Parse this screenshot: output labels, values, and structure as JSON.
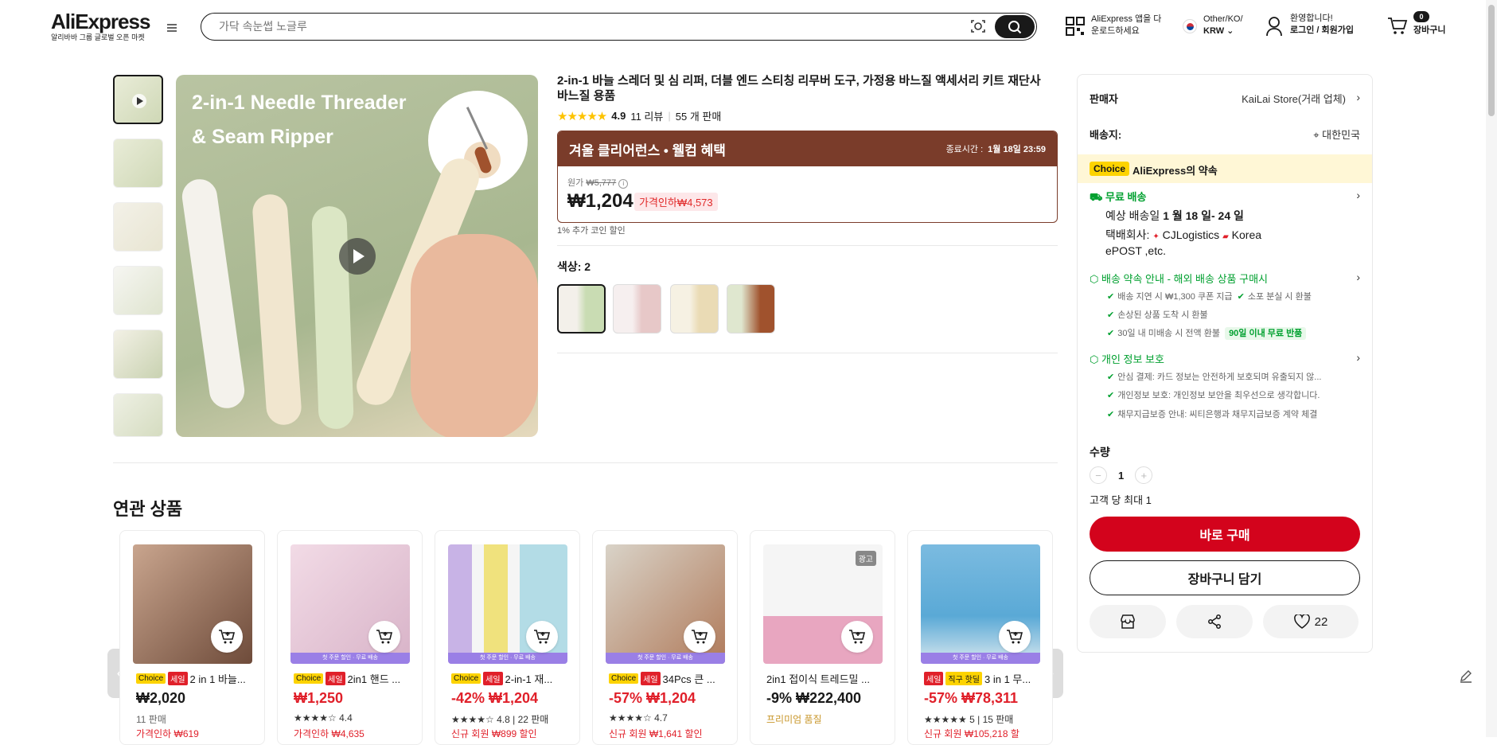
{
  "header": {
    "logo": "AliExpress",
    "logo_sub": "알리바바 그룹 글로벌 오픈 마켓",
    "search_placeholder": "가닥 속눈썹 노글루",
    "app_line1": "AliExpress 앱을 다",
    "app_line2": "운로드하세요",
    "region_line1": "Other/KO/",
    "region_line2": "KRW",
    "account_line1": "환영합니다!",
    "account_line2": "로그인 / 회원가입",
    "cart_count": "0",
    "cart_label": "장바구니"
  },
  "product": {
    "title": "2-in-1 바늘 스레더 및 심 리퍼, 더블 엔드 스티칭 리무버 도구, 가정용 바느질 액세서리 키트 재단사 바느질 용품",
    "rating": "4.9",
    "reviews": "11 리뷰",
    "sold": "55 개 판매",
    "image_text_line1": "2-in-1 Needle Threader",
    "image_text_line2": "& Seam Ripper",
    "promo_title": "겨울 클리어런스 • 웰컴 혜택",
    "promo_end_label": "종료시간 :",
    "promo_end_value": "1월 18일 23:59",
    "orig_label": "원가",
    "orig_price": "₩5,777",
    "price": "₩1,204",
    "discount_tag": "가격인하₩4,573",
    "coin_note": "1% 추가 코인 할인",
    "color_label": "색상: 2",
    "swatch_labels": [
      "Green",
      "Pink",
      "Yellow",
      "Set"
    ]
  },
  "panel": {
    "seller_label": "판매자",
    "seller_value": "KaiLai Store(거래 업체)",
    "ship_to_label": "배송지:",
    "ship_to_value": "대한민국",
    "choice_badge": "Choice",
    "promise": "AliExpress의 약속",
    "free_ship": "무료 배송",
    "eta_prefix": "예상 배송일",
    "eta_value": "1 월 18 일- 24 일",
    "carrier_line1_prefix": "택배회사:",
    "carrier_a": "CJLogistics",
    "carrier_b": "Korea",
    "carrier_line2": "ePOST ,etc.",
    "guarantee_title": "배송 약속 안내 - 해외 배송 상품 구매시",
    "g1a": "배송 지연 시 ₩1,300 쿠폰 지급",
    "g1b": "소포 분실 시 환불",
    "g2": "손상된 상품 도착 시 환불",
    "g3": "30일 내 미배송 시 전액 환불",
    "g3_badge": "90일 이내 무료 반품",
    "privacy_title": "개인 정보 보호",
    "p1": "안심 결제: 카드 정보는 안전하게 보호되며 유출되지 않...",
    "p2": "개인정보 보호: 개인정보 보안을 최우선으로 생각합니다.",
    "p3": "채무지급보증 안내: 씨티은행과 채무지급보증 계약 체결",
    "qty_label": "수량",
    "qty_minus": "−",
    "qty_value": "1",
    "qty_plus": "+",
    "limit": "고객 당 최대 1",
    "buy_now": "바로 구매",
    "add_cart": "장바구니 담기",
    "wish_count": "22"
  },
  "related": {
    "title": "연관 상품",
    "cards": [
      {
        "badges": [
          "Choice",
          "세일"
        ],
        "name": "2 in 1 바늘...",
        "price": "₩2,020",
        "sub": "11 판매",
        "foot": "가격인하 ₩619",
        "band": "",
        "red": false,
        "ad": ""
      },
      {
        "badges": [
          "Choice",
          "세일"
        ],
        "name": "2in1 핸드 ...",
        "price": "₩1,250",
        "sub": "★★★★☆ 4.4",
        "foot": "가격인하 ₩4,635",
        "band": "첫 주문 할인 · 무료 배송",
        "red": true,
        "ad": ""
      },
      {
        "badges": [
          "Choice",
          "세일"
        ],
        "name": "2-in-1 재...",
        "price": "-42% ₩1,204",
        "sub": "★★★★☆ 4.8 | 22 판매",
        "foot": "신규 회원 ₩899 할인",
        "band": "첫 주문 할인 · 무료 배송",
        "red": true,
        "ad": ""
      },
      {
        "badges": [
          "Choice",
          "세일"
        ],
        "name": "34Pcs 큰 ...",
        "price": "-57% ₩1,204",
        "sub": "★★★★☆ 4.7",
        "foot": "신규 회원 ₩1,641 할인",
        "band": "첫 주문 할인 · 무료 배송",
        "red": true,
        "ad": ""
      },
      {
        "badges": [],
        "name": "2in1 접이식 트레드밀 ...",
        "price": "-9% ₩222,400",
        "sub": "프리미엄 품질",
        "foot": "",
        "band": "",
        "red": false,
        "ad": "광고"
      },
      {
        "badges": [
          "세일",
          "직구 핫딜"
        ],
        "name": "3 in 1 무...",
        "price": "-57% ₩78,311",
        "sub": "★★★★★ 5 | 15 판매",
        "foot": "신규 회원 ₩105,218 할",
        "band": "첫 주문 할인 · 무료 배송",
        "red": true,
        "ad": ""
      }
    ]
  },
  "colors": {
    "accent_red": "#d3031c",
    "promo_brown": "#7a3c2a",
    "choice_yellow": "#fdd300",
    "green": "#00a02f",
    "star": "#fdc300"
  }
}
